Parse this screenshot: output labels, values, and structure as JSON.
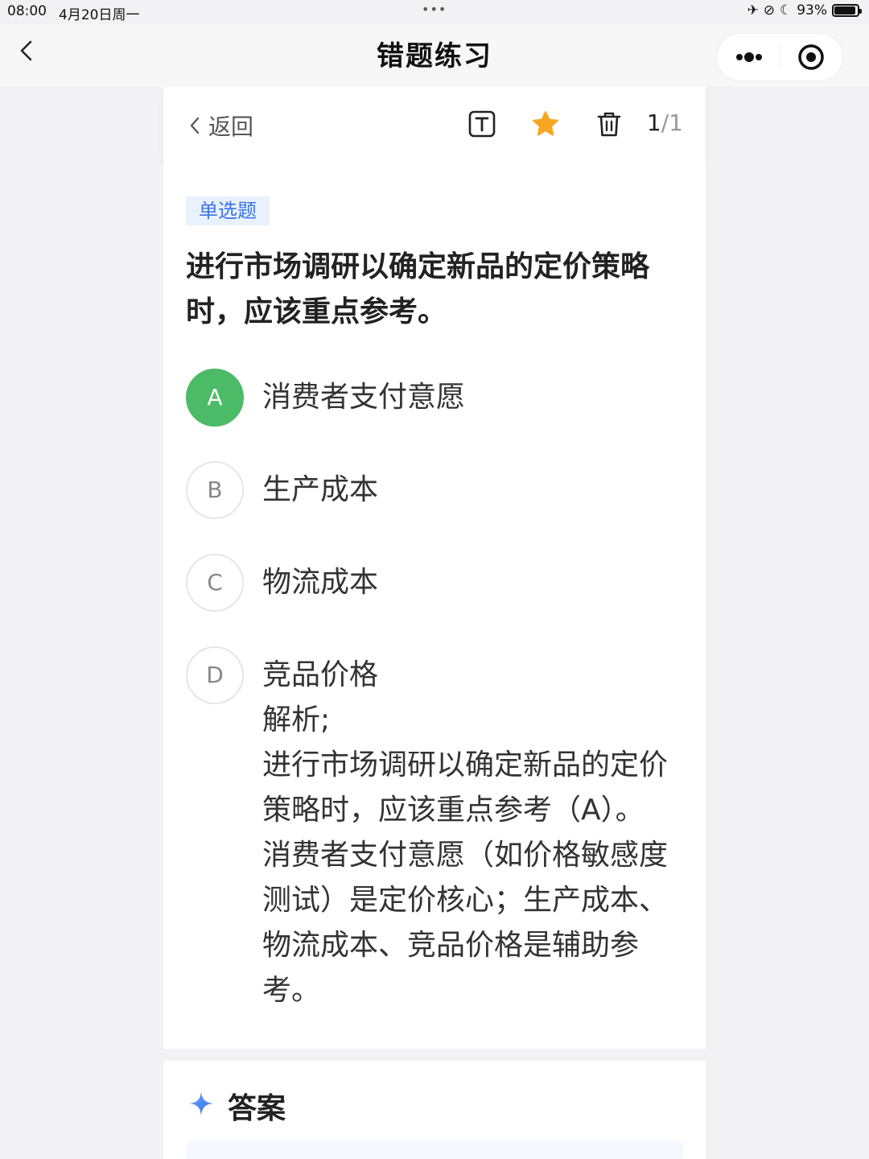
{
  "status": {
    "time": "08:00",
    "date": "4月20日周一",
    "battery": "93%",
    "battery_level": 0.93
  },
  "nav": {
    "title": "错题练习",
    "back_icon": "chevron-left-icon",
    "more_icon": "more-dots-icon",
    "close_icon": "target-circle-icon"
  },
  "toolbar": {
    "back_label": "返回",
    "font_icon": "text-size-icon",
    "favorite_icon": "star-icon",
    "favorite_color": "#f6a623",
    "delete_icon": "trash-icon",
    "current": "1",
    "separator": "/",
    "total": "1"
  },
  "question": {
    "type_tag": "单选题",
    "text": "进行市场调研以确定新品的定价策略时，应该重点参考。",
    "options": [
      {
        "letter": "A",
        "text": "消费者支付意愿",
        "correct": true
      },
      {
        "letter": "B",
        "text": "生产成本",
        "correct": false
      },
      {
        "letter": "C",
        "text": "物流成本",
        "correct": false
      },
      {
        "letter": "D",
        "text": "竞品价格",
        "correct": false
      }
    ],
    "explanation": "解析;\n进行市场调研以确定新品的定价策略时，应该重点参考（A）。消费者支付意愿（如价格敏感度测试）是定价核心；生产成本、物流成本、竞品价格是辅助参考。"
  },
  "answer": {
    "title": "答案",
    "icon": "sparkle-icon"
  },
  "colors": {
    "correct": "#4cbb67",
    "tag_bg": "#eaf1fe",
    "tag_text": "#3a73e8"
  }
}
